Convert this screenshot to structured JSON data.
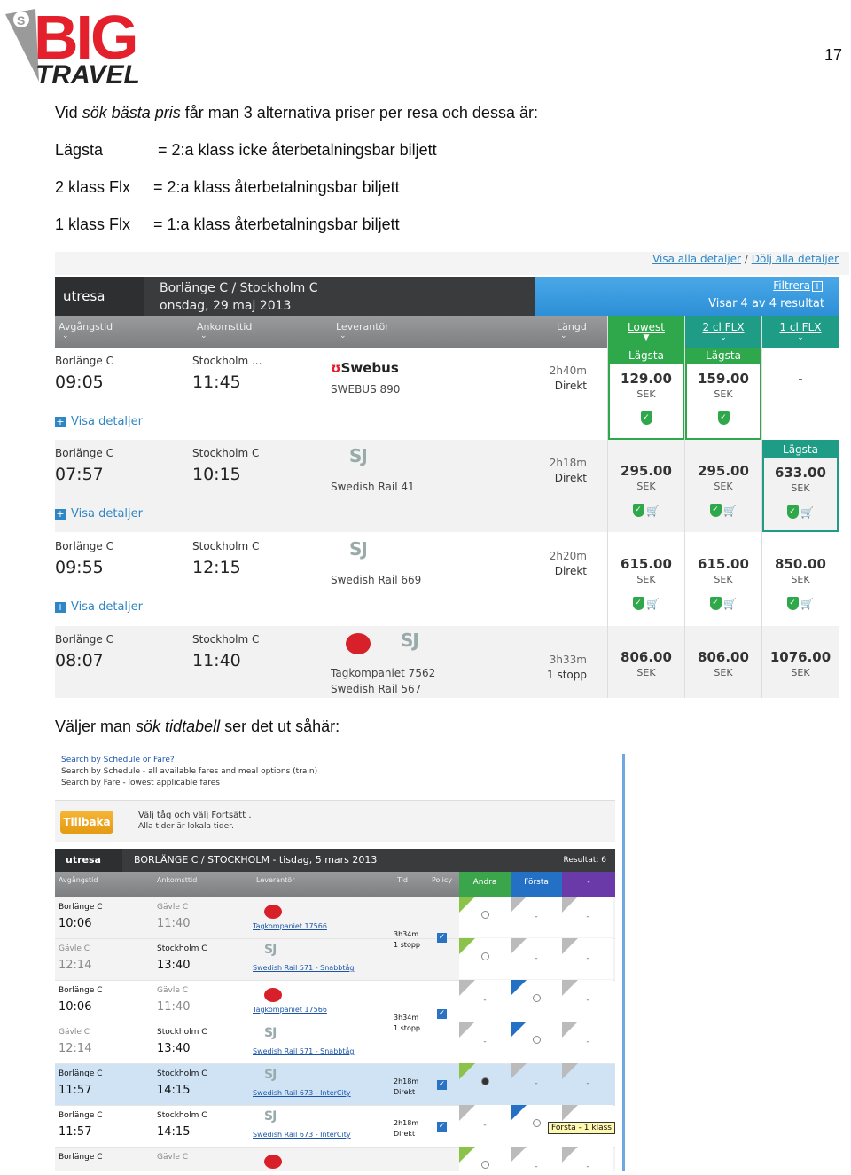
{
  "logo": {
    "text_big": "BIG",
    "text_travel": "TRAVEL"
  },
  "page_number": "17",
  "intro": {
    "pre": "Vid ",
    "em": "sök bästa pris",
    "post": " får man 3 alternativa priser per resa och dessa är:"
  },
  "definitions": [
    {
      "term": "Lägsta",
      "def": "= 2:a klass icke återbetalningsbar biljett"
    },
    {
      "term": "2 klass Flx",
      "def": "= 2:a klass återbetalningsbar biljett"
    },
    {
      "term": "1 klass Flx",
      "def": "= 1:a klass återbetalningsbar biljett"
    }
  ],
  "shot1": {
    "link_show": "Visa alla detaljer",
    "link_sep": "/",
    "link_hide": "Dölj alla detaljer",
    "direction": "utresa",
    "route": "Borlänge C / Stockholm C",
    "date": "onsdag, 29 maj 2013",
    "filter": "Filtrera",
    "result": "Visar 4 av 4 resultat",
    "cols": {
      "dep": "Avgångstid",
      "arr": "Ankomsttid",
      "sup": "Leverantör",
      "len": "Längd",
      "c1": "Lowest",
      "c2": "2 cl FLX",
      "c3": "1 cl FLX"
    },
    "details": "Visa detaljer",
    "rows": [
      {
        "from": "Borlänge C",
        "dep": "09:05",
        "to": "Stockholm ...",
        "arr": "11:45",
        "op_logo": "Swebus",
        "op": "SWEBUS 890",
        "dur": "2h40m",
        "stops": "Direkt",
        "p1": "129.00",
        "p2": "159.00",
        "p3": "-",
        "l1": "Lägsta",
        "l2": "Lägsta",
        "l3": ""
      },
      {
        "from": "Borlänge C",
        "dep": "07:57",
        "to": "Stockholm C",
        "arr": "10:15",
        "op_logo": "SJ",
        "op": "Swedish Rail 41",
        "dur": "2h18m",
        "stops": "Direkt",
        "p1": "295.00",
        "p2": "295.00",
        "p3": "633.00",
        "l1": "",
        "l2": "",
        "l3": "Lägsta"
      },
      {
        "from": "Borlänge C",
        "dep": "09:55",
        "to": "Stockholm C",
        "arr": "12:15",
        "op_logo": "SJ",
        "op": "Swedish Rail 669",
        "dur": "2h20m",
        "stops": "Direkt",
        "p1": "615.00",
        "p2": "615.00",
        "p3": "850.00"
      },
      {
        "from": "Borlänge C",
        "dep": "08:07",
        "to": "Stockholm C",
        "arr": "11:40",
        "op_logo": "SJ",
        "op": "Tagkompaniet 7562",
        "op2": "Swedish Rail 567",
        "dur": "3h33m",
        "stops": "1 stopp",
        "p1": "806.00",
        "p2": "806.00",
        "p3": "1076.00"
      }
    ],
    "currency": "SEK",
    "colors": {
      "green": "#2ea84a",
      "teal": "#1f9c86",
      "blue": "#2f86c4"
    }
  },
  "middle": {
    "pre": "Väljer man ",
    "em": "sök tidtabell",
    "post": " ser det ut såhär:"
  },
  "shot2": {
    "intro_lines": [
      "Search by Schedule or Fare?",
      "Search by Schedule - all available fares and meal options (train)",
      "Search by Fare - lowest applicable fares"
    ],
    "back": "Tillbaka",
    "instr1": "Välj tåg och välj Fortsätt .",
    "instr2": "Alla tider är lokala tider.",
    "direction": "utresa",
    "route": "BORLÄNGE C / STOCKHOLM - tisdag, 5 mars 2013",
    "result": "Resultat: 6",
    "cols": {
      "dep": "Avgångstid",
      "arr": "Ankomsttid",
      "sup": "Leverantör",
      "time": "Tid",
      "policy": "Policy",
      "c1": "Andra",
      "c2": "Första",
      "c3": "-"
    },
    "tooltip": "Första - 1 klass",
    "rows": [
      {
        "a": "Borlänge C",
        "at": "10:06",
        "b": "Gävle C",
        "bt": "11:40",
        "lev": "Tagkompaniet   17566",
        "dim_b": true
      },
      {
        "a": "Gävle C",
        "at": "12:14",
        "b": "Stockholm C",
        "bt": "13:40",
        "lev": "Swedish Rail   571 - Snabbtåg",
        "dim_a": true,
        "t1": "3h34m",
        "t2": "1 stopp"
      },
      {
        "a": "Borlänge C",
        "at": "10:06",
        "b": "Gävle C",
        "bt": "11:40",
        "lev": "Tagkompaniet   17566",
        "dim_b": true
      },
      {
        "a": "Gävle C",
        "at": "12:14",
        "b": "Stockholm C",
        "bt": "13:40",
        "lev": "Swedish Rail   571 - Snabbtåg",
        "dim_a": true,
        "t1": "3h34m",
        "t2": "1 stopp"
      },
      {
        "a": "Borlänge C",
        "at": "11:57",
        "b": "Stockholm C",
        "bt": "14:15",
        "lev": "Swedish Rail   673 - InterCity",
        "t1": "2h18m",
        "t2": "Direkt"
      },
      {
        "a": "Borlänge C",
        "at": "11:57",
        "b": "Stockholm C",
        "bt": "14:15",
        "lev": "Swedish Rail   673 - InterCity",
        "t1": "2h18m",
        "t2": "Direkt"
      },
      {
        "a": "Borlänge C",
        "at": "",
        "b": "Gävle C",
        "bt": "",
        "lev": "",
        "dim_b": true
      }
    ],
    "dash": "-"
  }
}
